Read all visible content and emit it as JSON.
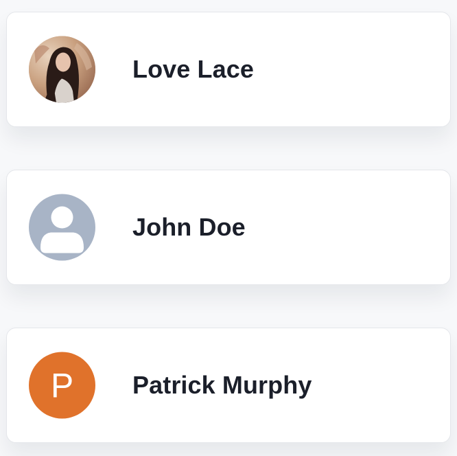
{
  "contacts": [
    {
      "name": "Love Lace",
      "avatar": {
        "kind": "photo",
        "icon": "person-photo"
      }
    },
    {
      "name": "John Doe",
      "avatar": {
        "kind": "placeholder",
        "icon": "user-icon",
        "color": "#a8b4c6"
      }
    },
    {
      "name": "Patrick Murphy",
      "avatar": {
        "kind": "initial",
        "initial": "P",
        "color": "#e0722b"
      }
    }
  ]
}
